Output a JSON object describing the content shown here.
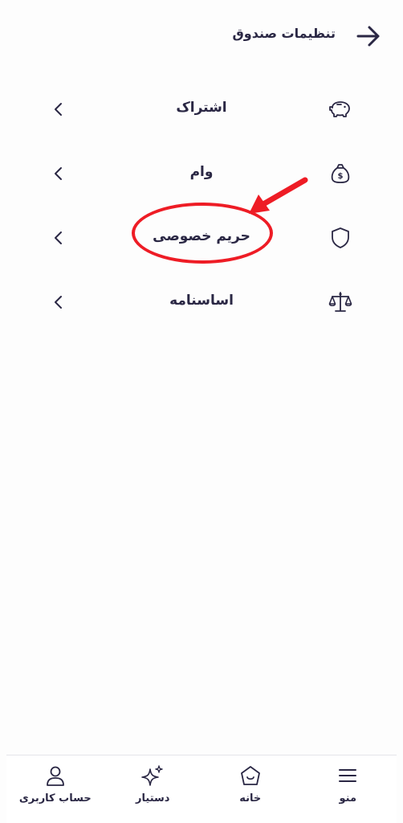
{
  "header": {
    "title": "تنظیمات صندوق",
    "back_icon": "arrow-right-icon"
  },
  "menu": {
    "items": [
      {
        "label": "اشتراک",
        "icon": "piggy-bank-icon"
      },
      {
        "label": "وام",
        "icon": "money-bag-icon"
      },
      {
        "label": "حریم خصوصی",
        "icon": "shield-icon"
      },
      {
        "label": "اساسنامه",
        "icon": "scales-icon"
      }
    ]
  },
  "annotation": {
    "highlighted_item": "حریم خصوصی",
    "color": "#ee1c25"
  },
  "bottom_nav": {
    "items": [
      {
        "label": "منو",
        "icon": "hamburger-menu-icon"
      },
      {
        "label": "خانه",
        "icon": "home-icon"
      },
      {
        "label": "دستیار",
        "icon": "sparkle-icon"
      },
      {
        "label": "حساب کاربری",
        "icon": "user-icon"
      }
    ]
  },
  "colors": {
    "text": "#2a2744",
    "background": "#fdfdfd",
    "accent": "#ee1c25"
  }
}
